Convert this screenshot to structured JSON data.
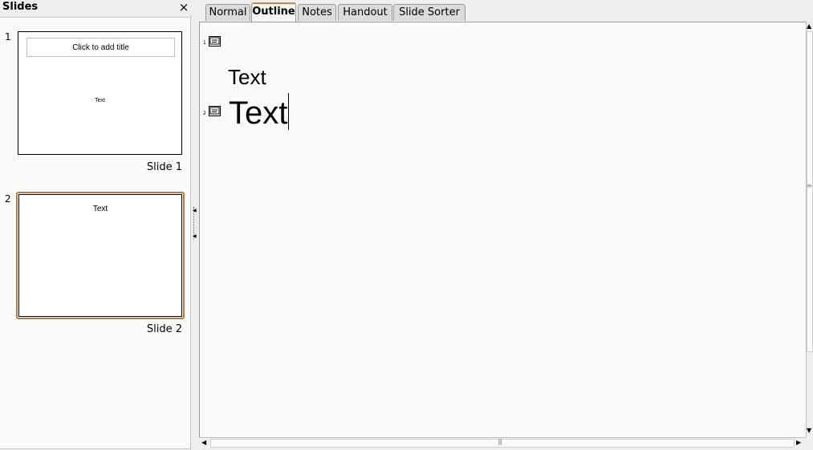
{
  "slides_panel": {
    "title": "Slides",
    "close_glyph": "×",
    "slides": [
      {
        "number": "1",
        "title_placeholder": "Click to add title",
        "body_text": "Text",
        "label": "Slide 1"
      },
      {
        "number": "2",
        "body_text": "Text",
        "label": "Slide 2"
      }
    ]
  },
  "tabs": [
    {
      "label": "Normal"
    },
    {
      "label": "Outline"
    },
    {
      "label": "Notes"
    },
    {
      "label": "Handout"
    },
    {
      "label": "Slide Sorter"
    }
  ],
  "outline": {
    "entries": [
      {
        "number": "1",
        "title": "",
        "body": "Text"
      },
      {
        "number": "2",
        "title": "Text"
      }
    ]
  },
  "colors": {
    "selection_border": "#b87a40",
    "active_tab_accent": "#d08a3c"
  }
}
